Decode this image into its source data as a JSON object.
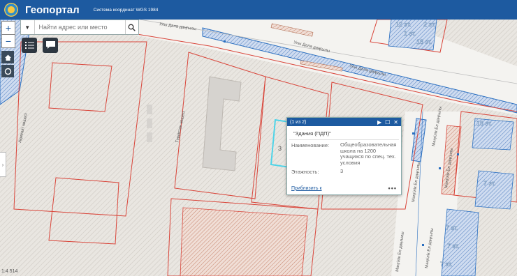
{
  "header": {
    "app_title": "Геопортал",
    "coord_system": "Система координат WGS 1984"
  },
  "search": {
    "placeholder": "Найти адрес или место"
  },
  "map": {
    "scale": "1:4 514",
    "streets": [
      "Улы Дала даңғылы",
      "Улы Дала даңғылы",
      "Улы Дала даңғылы",
      "Түркістан көшесі",
      "Ақмешіт көшесі",
      "Мәңгілік Ел даңғылы",
      "Мәңгілік Ел даңғылы",
      "Мәңгілік Ел даңғылы",
      "Мәңгілік Ел даңғылы",
      "Мәңгілік Ел даңғылы"
    ],
    "floors": [
      "12 эт.",
      "1 эт.",
      "2 эт.",
      "18 эт.",
      "18 эт.",
      "7 эт.",
      "7 эт.",
      "7 эт.",
      "7 эт.",
      "3"
    ]
  },
  "popup": {
    "counter": "(1 из 2)",
    "title": "\"Здания (ПДП)\"",
    "fields": [
      {
        "key": "Наименование:",
        "value": "Общеобразовательная школа на 1200 учащихся по спец. тех. условия"
      },
      {
        "key": "Этажность:",
        "value": "3"
      }
    ],
    "zoom_link": "Приблизить к",
    "more": "•••"
  },
  "colors": {
    "header": "#1d5aa0",
    "parcel_line": "#d9453a",
    "road_blue": "#2a6fc0"
  }
}
